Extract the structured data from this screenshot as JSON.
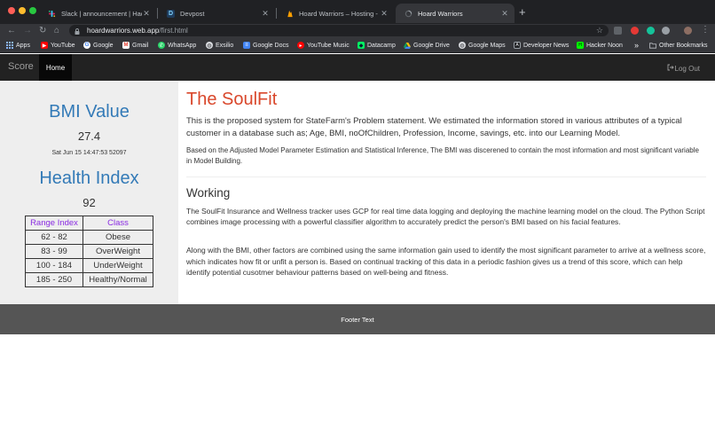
{
  "browser": {
    "tabs": [
      {
        "label": "Slack | announcement | HackUl",
        "icon": "slack-icon"
      },
      {
        "label": "Devpost",
        "icon": "devpost-icon"
      },
      {
        "label": "Hoard Warriors – Hosting - Fireb",
        "icon": "firebase-icon"
      },
      {
        "label": "Hoard Warriors",
        "icon": "loading-icon"
      }
    ],
    "url_host": "hoardwarriors.web.app",
    "url_path": "/first.html",
    "bookmarks": [
      {
        "label": "Apps",
        "icon": "apps-grid-icon"
      },
      {
        "label": "YouTube",
        "icon": "youtube-icon"
      },
      {
        "label": "Google",
        "icon": "google-icon"
      },
      {
        "label": "Gmail",
        "icon": "gmail-icon"
      },
      {
        "label": "WhatsApp",
        "icon": "whatsapp-icon"
      },
      {
        "label": "Exsilio",
        "icon": "globe-icon"
      },
      {
        "label": "Google Docs",
        "icon": "google-docs-icon"
      },
      {
        "label": "YouTube Music",
        "icon": "youtube-music-icon"
      },
      {
        "label": "Datacamp",
        "icon": "datacamp-icon"
      },
      {
        "label": "Google Drive",
        "icon": "google-drive-icon"
      },
      {
        "label": "Google Maps",
        "icon": "globe-icon"
      },
      {
        "label": "Developer News",
        "icon": "developer-news-icon"
      },
      {
        "label": "Hacker Noon",
        "icon": "hacker-noon-icon"
      }
    ],
    "overflow": "»",
    "other_bookmarks": "Other Bookmarks"
  },
  "navbar": {
    "brand": "Score",
    "home": "Home",
    "logout": "Log Out"
  },
  "sidebar": {
    "bmi_title": "BMI Value",
    "bmi_value": "27.4",
    "timestamp": "Sat Jun 15 14:47:53 52097",
    "health_title": "Health Index",
    "health_value": "92",
    "table": {
      "headers": [
        "Range Index",
        "Class"
      ],
      "rows": [
        [
          "62 - 82",
          "Obese"
        ],
        [
          "83 - 99",
          "OverWeight"
        ],
        [
          "100 - 184",
          "UnderWeight"
        ],
        [
          "185 - 250",
          "Healthy/Normal"
        ]
      ]
    }
  },
  "main": {
    "title": "The SoulFit",
    "intro": "This is the proposed system for StateFarm's Problem statement. We estimated the information stored in various attributes of a typical customer in a database such as; Age, BMI, noOfChildren, Profession, Income, savings, etc. into our Learning Model.",
    "intro2": "Based on the Adjusted Model Parameter Estimation and Statistical Inference, The BMI was discerened to contain the most information and most significant variable in Model Building.",
    "working_title": "Working",
    "working1": "The SoulFit Insurance and Wellness tracker uses GCP for real time data logging and deploying the machine learning model on the cloud. The Python Script combines image processing with a powerful classifier algorithm to accurately predict the person's BMI based on his facial features.",
    "working2": "Along with the BMI, other factors are combined using the same information gain used to identify the most significant parameter to arrive at a wellness score, which indicates how fit or unfit a person is. Based on continual tracking of this data in a periodic fashion gives us a trend of this score, which can help identify potential cusotmer behaviour patterns based on well-being and fitness."
  },
  "footer": {
    "text": "Footer Text"
  }
}
